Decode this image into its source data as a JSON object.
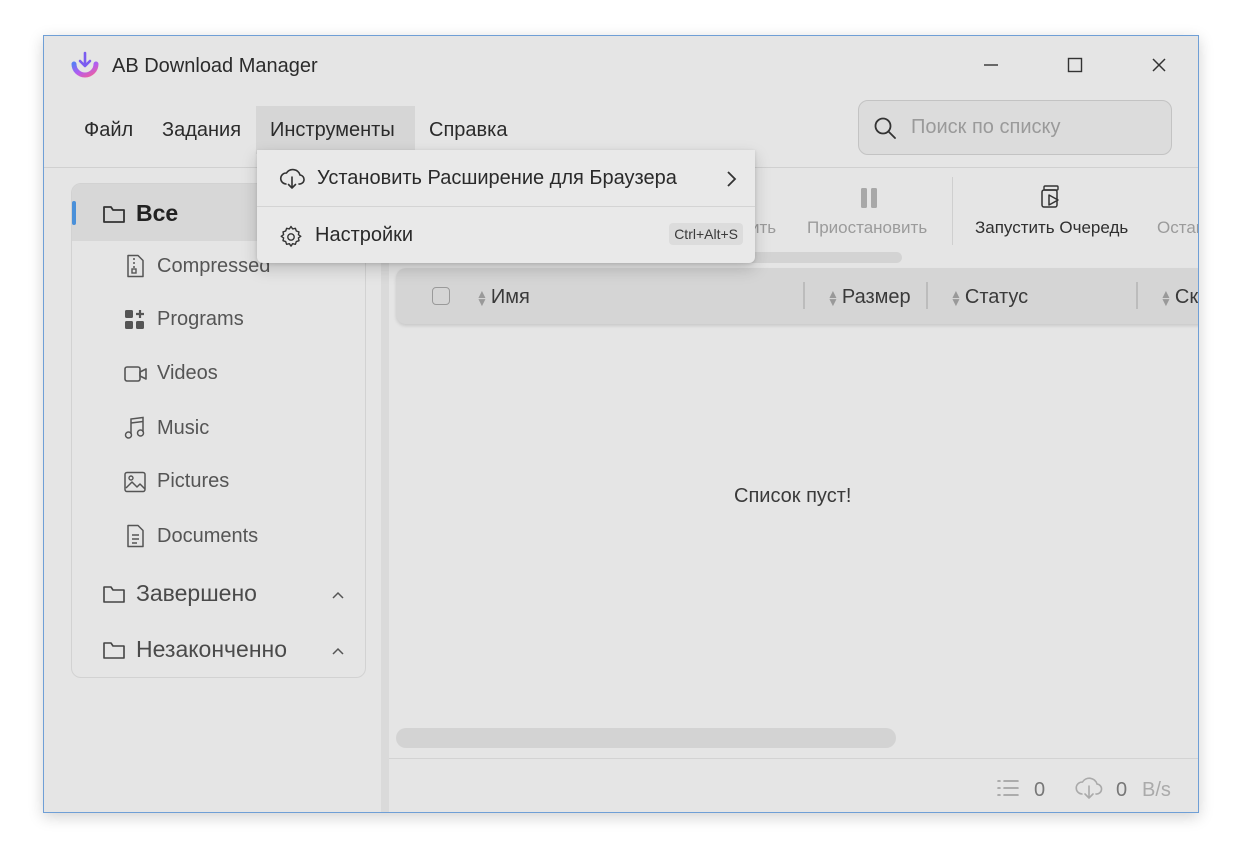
{
  "window": {
    "title": "AB Download Manager"
  },
  "menu": {
    "items": [
      {
        "label": "Файл"
      },
      {
        "label": "Задания"
      },
      {
        "label": "Инструменты"
      },
      {
        "label": "Справка"
      }
    ]
  },
  "search": {
    "placeholder": "Поиск по списку",
    "value": ""
  },
  "dropdown": {
    "items": [
      {
        "label": "Установить Расширение для Браузера",
        "shortcut": ""
      },
      {
        "label": "Настройки",
        "shortcut": "Ctrl+Alt+S"
      }
    ]
  },
  "sidebar": {
    "all": "Все",
    "categories": [
      {
        "label": "Compressed",
        "icon": "zip-file-icon"
      },
      {
        "label": "Programs",
        "icon": "apps-icon"
      },
      {
        "label": "Videos",
        "icon": "video-camera-icon"
      },
      {
        "label": "Music",
        "icon": "music-note-icon"
      },
      {
        "label": "Pictures",
        "icon": "image-icon"
      },
      {
        "label": "Documents",
        "icon": "document-icon"
      }
    ],
    "finished": "Завершено",
    "unfinished": "Незаконченно"
  },
  "toolbar": {
    "partial_left": "ить",
    "pause": "Приостановить",
    "start_queue": "Запустить Очередь",
    "partial_right": "Остан"
  },
  "table": {
    "columns": {
      "name": "Имя",
      "size": "Размер",
      "status": "Статус",
      "speed_partial": "Ск"
    },
    "empty_message": "Список пуст!"
  },
  "status_bar": {
    "count": "0",
    "speed_value": "0",
    "speed_unit": "B/s"
  },
  "colors": {
    "accent": "#4a90d9",
    "background": "#e5e5e5",
    "selection": "#d7d7d7"
  }
}
